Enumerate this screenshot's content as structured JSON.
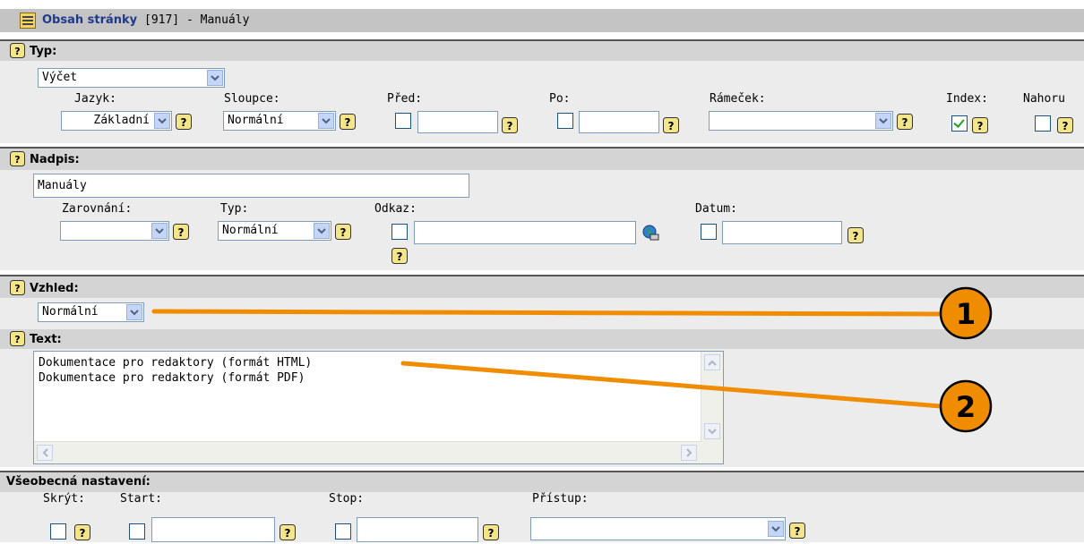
{
  "window": {
    "title_bold": "Obsah stránky",
    "title_rest": " [917] - Manuály",
    "icon": "page-content-icon"
  },
  "section_typ": {
    "heading": "Typ:",
    "typ_value": "Výčet",
    "labels": {
      "jazyk": "Jazyk:",
      "sloupce": "Sloupce:",
      "pred": "Před:",
      "po": "Po:",
      "ramecek": "Rámeček:",
      "index": "Index:",
      "nahoru": "Nahoru"
    },
    "jazyk_value": "Základní",
    "sloupce_value": "Normální",
    "pred_value": "",
    "po_value": "",
    "ramecek_value": "",
    "index_checked": true,
    "nahoru_checked": false
  },
  "section_nadpis": {
    "heading": "Nadpis:",
    "nadpis_value": "Manuály",
    "labels": {
      "zarovnani": "Zarovnání:",
      "typ": "Typ:",
      "odkaz": "Odkaz:",
      "datum": "Datum:"
    },
    "zarovnani_value": "",
    "typ_value": "Normální",
    "odkaz_value": "",
    "datum_value": ""
  },
  "section_vzhled": {
    "heading": "Vzhled:",
    "vzhled_value": "Normální"
  },
  "section_text": {
    "heading": "Text:",
    "lines": [
      "Dokumentace pro redaktory (formát HTML)",
      "Dokumentace pro redaktory (formát PDF)"
    ]
  },
  "section_vseobecne": {
    "heading": "Všeobecná nastavení:",
    "labels": {
      "skryt": "Skrýt:",
      "start": "Start:",
      "stop": "Stop:",
      "pristup": "Přístup:"
    },
    "start_value": "",
    "stop_value": "",
    "pristup_value": ""
  },
  "callouts": {
    "one": "1",
    "two": "2"
  },
  "colors": {
    "accent_orange": "#f08c00",
    "header_gray": "#c0c0c0",
    "section_gray": "#e6e6e6",
    "title_blue": "#1f3a8a"
  }
}
